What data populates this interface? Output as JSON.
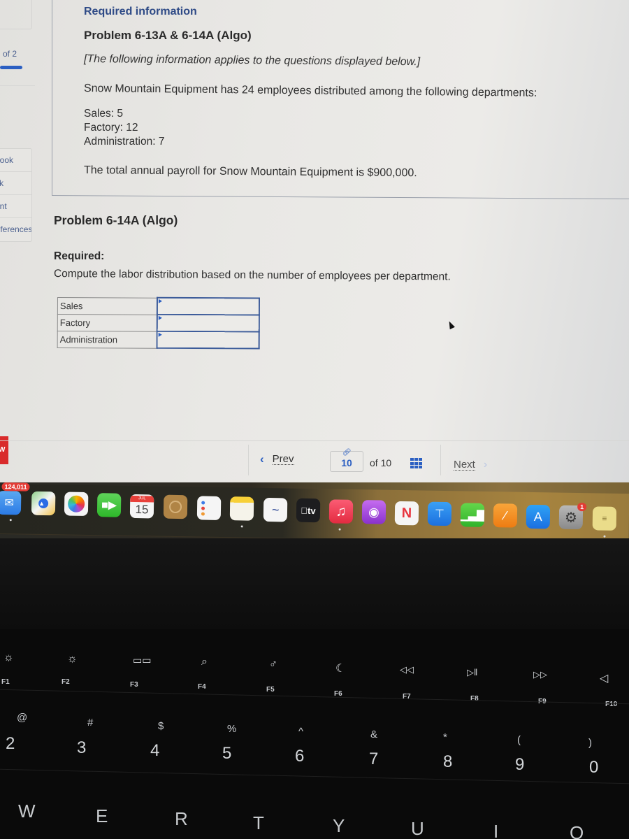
{
  "sidebar": {
    "progress_label": "of 2",
    "progress_fraction": 0.5,
    "menu": [
      "eBook",
      "Ask",
      "Print",
      "References"
    ],
    "red_badge": "W"
  },
  "info": {
    "heading": "Required information",
    "problem_title": "Problem 6-13A & 6-14A (Algo)",
    "applies_note": "[The following information applies to the questions displayed below.]",
    "intro": "Snow Mountain Equipment has 24 employees distributed among the following departments:",
    "departments": [
      "Sales: 5",
      "Factory: 12",
      "Administration: 7"
    ],
    "payroll": "The total annual payroll for Snow Mountain Equipment is $900,000."
  },
  "problem": {
    "title": "Problem 6-14A (Algo)",
    "required_label": "Required:",
    "required_text": "Compute the labor distribution based on the number of employees per department.",
    "rows": [
      {
        "label": "Sales",
        "value": ""
      },
      {
        "label": "Factory",
        "value": ""
      },
      {
        "label": "Administration",
        "value": ""
      }
    ]
  },
  "nav": {
    "prev_label": "Prev",
    "current_page": "10",
    "of_label": "of 10",
    "next_label": "Next"
  },
  "dock": {
    "mail_badge": "124,011",
    "calendar_month": "JUL",
    "calendar_day": "15",
    "tv_label": "tv",
    "settings_badge": "1",
    "apps": [
      "Mail",
      "Maps",
      "Photos",
      "FaceTime",
      "Calendar",
      "Contacts",
      "Reminders",
      "Notes",
      "Freeform",
      "TV",
      "Music",
      "Podcasts",
      "News",
      "Keynote",
      "Numbers",
      "Pages",
      "App Store",
      "System Settings",
      "Stickies"
    ]
  },
  "keyboard": {
    "fn_keys": [
      {
        "label": "F1",
        "icon": "brightness-down-icon"
      },
      {
        "label": "F2",
        "icon": "brightness-up-icon"
      },
      {
        "label": "F3",
        "icon": "mission-control-icon"
      },
      {
        "label": "F4",
        "icon": "search-icon"
      },
      {
        "label": "F5",
        "icon": "microphone-icon"
      },
      {
        "label": "F6",
        "icon": "moon-icon"
      },
      {
        "label": "F7",
        "icon": "rewind-icon"
      },
      {
        "label": "F8",
        "icon": "play-pause-icon"
      },
      {
        "label": "F9",
        "icon": "fast-forward-icon"
      },
      {
        "label": "F10",
        "icon": "mute-icon"
      }
    ],
    "number_keys": [
      {
        "top": "@",
        "main": "2"
      },
      {
        "top": "#",
        "main": "3"
      },
      {
        "top": "$",
        "main": "4"
      },
      {
        "top": "%",
        "main": "5"
      },
      {
        "top": "^",
        "main": "6"
      },
      {
        "top": "&",
        "main": "7"
      },
      {
        "top": "*",
        "main": "8"
      },
      {
        "top": "(",
        "main": "9"
      },
      {
        "top": ")",
        "main": "0"
      }
    ],
    "letter_keys": [
      "W",
      "E",
      "R",
      "T",
      "Y",
      "U",
      "I",
      "O"
    ]
  }
}
